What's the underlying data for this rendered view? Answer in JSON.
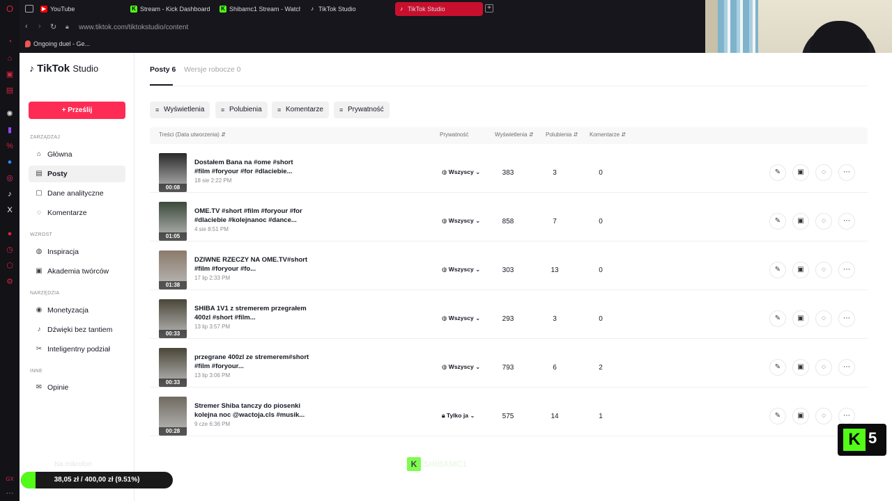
{
  "browser": {
    "tabs": [
      {
        "label": "YouTube",
        "icon": "youtube-icon",
        "color": "#ff0000"
      },
      {
        "label": "Stream - Kick Dashboard",
        "icon": "kick-icon",
        "color": "#53fc18"
      },
      {
        "label": "Shibamc1 Stream - Watch",
        "icon": "kick-icon",
        "color": "#53fc18"
      },
      {
        "label": "TikTok Studio",
        "icon": "tiktok-icon",
        "color": "#000000"
      },
      {
        "label": "TikTok Studio",
        "icon": "tiktok-icon",
        "color": "#000000"
      }
    ],
    "url": "www.tiktok.com/tiktokstudio/content",
    "bookmark": "Ongoing duel - Ge..."
  },
  "studio": {
    "logo_main": "TikTok",
    "logo_sub": "Studio",
    "upload_label": "Prześlij",
    "accent": "#fe2c55"
  },
  "nav": {
    "sections": [
      "ZARZĄDZAJ",
      "WZROST",
      "NARZĘDZIA",
      "INNE"
    ],
    "items": [
      {
        "label": "Główna",
        "icon": "home-icon"
      },
      {
        "label": "Posty",
        "icon": "posts-icon"
      },
      {
        "label": "Dane analityczne",
        "icon": "analytics-icon"
      },
      {
        "label": "Komentarze",
        "icon": "comments-icon"
      },
      {
        "label": "Inspiracja",
        "icon": "bulb-icon"
      },
      {
        "label": "Akademia twórców",
        "icon": "academy-icon"
      },
      {
        "label": "Monetyzacja",
        "icon": "money-icon"
      },
      {
        "label": "Dźwięki bez tantiem",
        "icon": "music-icon"
      },
      {
        "label": "Inteligentny podział",
        "icon": "split-icon"
      },
      {
        "label": "Opinie",
        "icon": "feedback-icon"
      }
    ]
  },
  "tabs": {
    "posts": "Posty 6",
    "drafts": "Wersje robocze 0"
  },
  "filters": [
    "Wyświetlenia",
    "Polubienia",
    "Komentarze",
    "Prywatność"
  ],
  "table": {
    "headers": [
      "Treści (Data utworzenia)",
      "Prywatność",
      "Wyświetlenia",
      "Polubienia",
      "Komentarze"
    ],
    "rows": [
      {
        "title": "Dostałem Bana na #ome #short #film #foryour #for #dlaciebie...",
        "date": "18 sie 2:22 PM",
        "duration": "00:08",
        "privacy": "Wszyscy",
        "views": "383",
        "likes": "3",
        "comments": "0",
        "thumb": "#2a2a2a"
      },
      {
        "title": "OME.TV #short #film #foryour #for #dlaciebie #kolejnanoc #dance...",
        "date": "4 sie 8:51 PM",
        "duration": "01:05",
        "privacy": "Wszyscy",
        "views": "858",
        "likes": "7",
        "comments": "0",
        "thumb": "#3b4a3a"
      },
      {
        "title": "DZIWNE RZECZY NA OME.TV#short #film #foryour #fo...",
        "date": "17 lip 2:33 PM",
        "duration": "01:38",
        "privacy": "Wszyscy",
        "views": "303",
        "likes": "13",
        "comments": "0",
        "thumb": "#8a7a6a"
      },
      {
        "title": "SHIBA 1V1 z stremerem przegrałem 400zl #short #film...",
        "date": "13 lip 3:57 PM",
        "duration": "00:33",
        "privacy": "Wszyscy",
        "views": "293",
        "likes": "3",
        "comments": "0",
        "thumb": "#4a4638"
      },
      {
        "title": "przegrane 400zl ze stremerem#short #film #foryour...",
        "date": "13 lip 3:06 PM",
        "duration": "00:33",
        "privacy": "Wszyscy",
        "views": "793",
        "likes": "6",
        "comments": "2",
        "thumb": "#4a4638"
      },
      {
        "title": "Stremer Shiba tanczy do piosenki kolejna noc @wactoja.cls #musik...",
        "date": "9 cze 6:36 PM",
        "duration": "00:28",
        "privacy": "Tylko ja",
        "views": "575",
        "likes": "14",
        "comments": "1",
        "thumb": "#6f6a60"
      }
    ]
  },
  "overlay": {
    "donation_label": "Na mikrofon",
    "donation_progress": "38,05 zł / 400,00 zł (9.51%)",
    "donation_fraction": 0.0951,
    "kick_badge": "5",
    "watermark": "SHIBAMC1"
  }
}
